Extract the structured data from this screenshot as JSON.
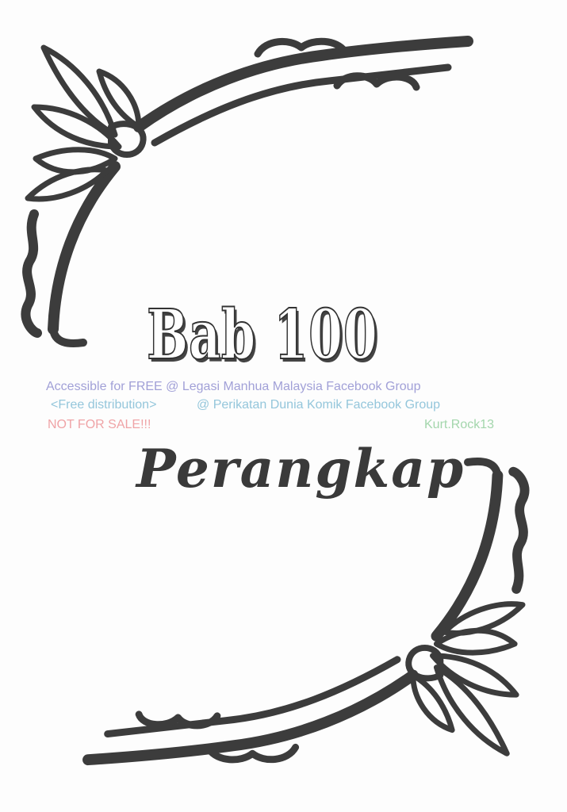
{
  "chapter_heading": "Bab 100",
  "chapter_title": "Perangkap",
  "watermarks": {
    "line1": "Accessible for FREE @ Legasi Manhua Malaysia Facebook Group",
    "line2_left": "<Free distribution>",
    "line2_right": "@ Perikatan Dunia Komik Facebook Group",
    "line3_left": "NOT FOR SALE!!!",
    "line3_right": "Kurt.Rock13"
  },
  "colors": {
    "ornament": "#3c3c3c",
    "page": "#fdfdfd",
    "watermark_purple": "#9d9cd6",
    "watermark_blue": "#8fc4da",
    "watermark_red": "#ef9fa2",
    "watermark_green": "#9fd4a8"
  }
}
